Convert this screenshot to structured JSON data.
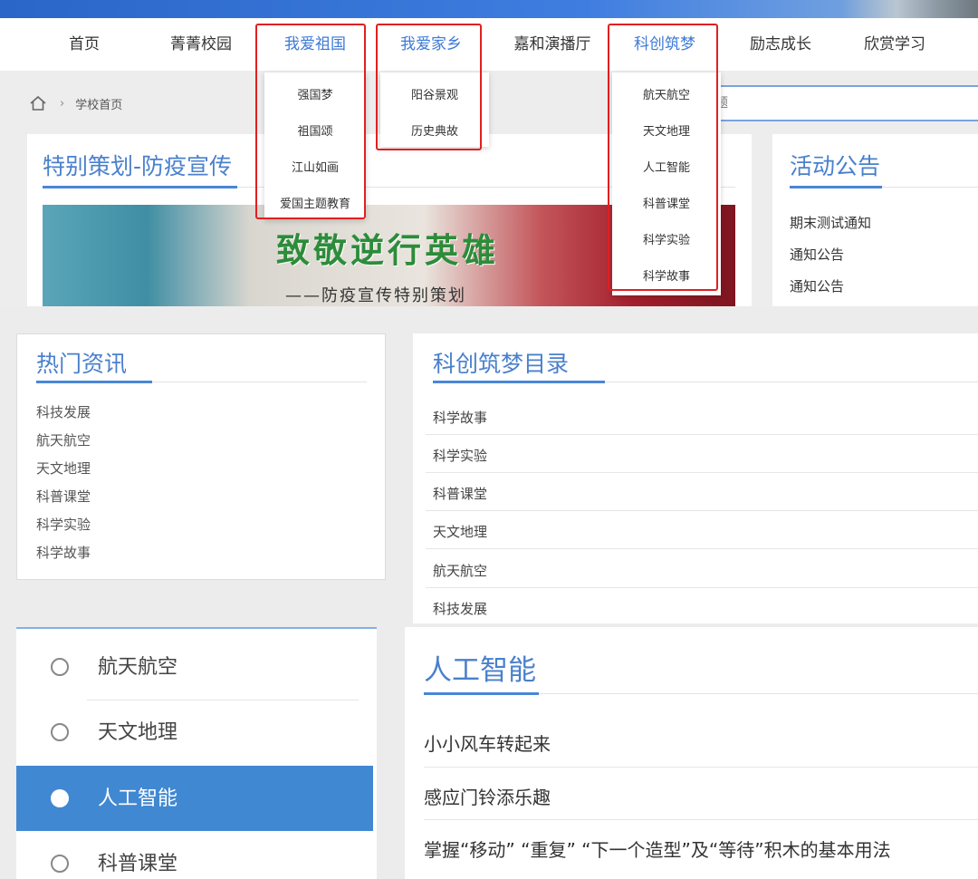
{
  "nav": {
    "items": [
      "首页",
      "菁菁校园",
      "我爱祖国",
      "我爱家乡",
      "嘉和演播厅",
      "科创筑梦",
      "励志成长",
      "欣赏学习"
    ]
  },
  "dropdowns": {
    "patriotic": [
      "强国梦",
      "祖国颂",
      "江山如画",
      "爱国主题教育"
    ],
    "hometown": [
      "阳谷景观",
      "历史典故"
    ],
    "science": [
      "航天航空",
      "天文地理",
      "人工智能",
      "科普课堂",
      "科学实验",
      "科学故事"
    ]
  },
  "breadcrumb": {
    "current": "学校首页"
  },
  "search": {
    "placeholder": "题"
  },
  "feature": {
    "title": "特别策划-防疫宣传",
    "hero_text": "致敬逆行英雄",
    "hero_sub": "——防疫宣传特别策划"
  },
  "notice": {
    "title": "活动公告",
    "items": [
      "期末测试通知",
      "通知公告",
      "通知公告"
    ]
  },
  "hot": {
    "title": "热门资讯",
    "items": [
      "科技发展",
      "航天航空",
      "天文地理",
      "科普课堂",
      "科学实验",
      "科学故事"
    ]
  },
  "catalog": {
    "title": "科创筑梦目录",
    "items": [
      "科学故事",
      "科学实验",
      "科普课堂",
      "天文地理",
      "航天航空",
      "科技发展"
    ]
  },
  "sidebar": {
    "items": [
      {
        "label": "航天航空",
        "active": false
      },
      {
        "label": "天文地理",
        "active": false
      },
      {
        "label": "人工智能",
        "active": true
      },
      {
        "label": "科普课堂",
        "active": false
      }
    ]
  },
  "ai": {
    "title": "人工智能",
    "items": [
      "小小风车转起来",
      "感应门铃添乐趣",
      "掌握“移动” “重复” “下一个造型”及“等待”积木的基本用法"
    ]
  },
  "colors": {
    "accent": "#4a80cc",
    "highlight": "#e02020",
    "active_bg": "#4188d2"
  }
}
